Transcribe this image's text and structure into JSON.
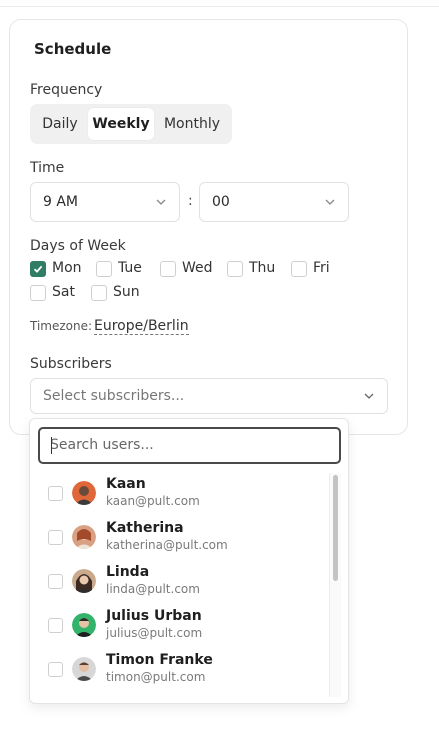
{
  "schedule": {
    "title": "Schedule",
    "frequency": {
      "label": "Frequency",
      "options": [
        "Daily",
        "Weekly",
        "Monthly"
      ],
      "selected": "Weekly"
    },
    "time": {
      "label": "Time",
      "hour": "9 AM",
      "separator": ":",
      "minute": "00"
    },
    "days": {
      "label": "Days of Week",
      "items": [
        {
          "label": "Mon",
          "checked": true
        },
        {
          "label": "Tue",
          "checked": false
        },
        {
          "label": "Wed",
          "checked": false
        },
        {
          "label": "Thu",
          "checked": false
        },
        {
          "label": "Fri",
          "checked": false
        },
        {
          "label": "Sat",
          "checked": false
        },
        {
          "label": "Sun",
          "checked": false
        }
      ]
    },
    "timezone": {
      "label": "Timezone:",
      "value": "Europe/Berlin"
    },
    "subscribers": {
      "label": "Subscribers",
      "placeholder": "Select subscribers..."
    }
  },
  "dropdown": {
    "search_placeholder": "Search users...",
    "users": [
      {
        "name": "Kaan",
        "email": "kaan@pult.com",
        "avatar_color": "#e0673a"
      },
      {
        "name": "Katherina",
        "email": "katherina@pult.com",
        "avatar_color": "#d9a184"
      },
      {
        "name": "Linda",
        "email": "linda@pult.com",
        "avatar_color": "#caa98c"
      },
      {
        "name": "Julius Urban",
        "email": "julius@pult.com",
        "avatar_color": "#34b36b"
      },
      {
        "name": "Timon Franke",
        "email": "timon@pult.com",
        "avatar_color": "#d7d7d7"
      }
    ]
  },
  "colors": {
    "accent": "#2e7d64",
    "border": "#e2e2e2"
  }
}
